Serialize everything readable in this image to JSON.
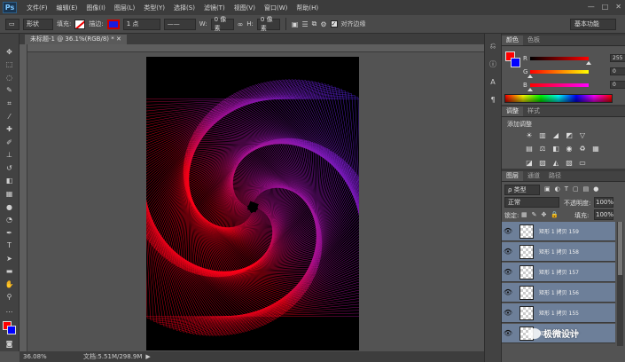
{
  "app": {
    "logo": "Ps"
  },
  "menu": [
    "文件(F)",
    "编辑(E)",
    "图像(I)",
    "图层(L)",
    "类型(Y)",
    "选择(S)",
    "滤镜(T)",
    "视图(V)",
    "窗口(W)",
    "帮助(H)"
  ],
  "window_controls": [
    "—",
    "□",
    "✕"
  ],
  "options": {
    "shape_mode": "形状",
    "fill_label": "填充:",
    "stroke_label": "描边:",
    "stroke_width": "1 点",
    "w_label": "W:",
    "w_value": "0 像素",
    "h_label": "H:",
    "h_value": "0 像素",
    "align_edges": "对齐边缘",
    "workspace": "基本功能"
  },
  "document": {
    "tab_title": "未标题-1 @ 36.1%(RGB/8) *",
    "zoom": "36.08%",
    "doc_size": "文档:5.51M/298.9M"
  },
  "colors_panel": {
    "tabs": [
      "颜色",
      "色板"
    ],
    "channels": [
      {
        "label": "R",
        "value": "255"
      },
      {
        "label": "G",
        "value": "0"
      },
      {
        "label": "B",
        "value": "0"
      }
    ],
    "foreground": "#ff0000",
    "background": "#0000ff"
  },
  "adjustments_panel": {
    "tabs": [
      "调整",
      "样式"
    ],
    "title": "添加调整"
  },
  "layers_panel": {
    "tabs": [
      "图层",
      "通道",
      "路径"
    ],
    "filter": "ρ 类型",
    "blend_mode": "正常",
    "opacity_label": "不透明度:",
    "opacity_value": "100%",
    "lock_label": "锁定:",
    "fill_label": "填充:",
    "fill_value": "100%",
    "layers": [
      {
        "name": "矩形 1 拷贝 159"
      },
      {
        "name": "矩形 1 拷贝 158"
      },
      {
        "name": "矩形 1 拷贝 157"
      },
      {
        "name": "矩形 1 拷贝 156"
      },
      {
        "name": "矩形 1 拷贝 155"
      },
      {
        "name": "矩形 1 拷贝 154"
      }
    ]
  },
  "watermark": "极微设计"
}
